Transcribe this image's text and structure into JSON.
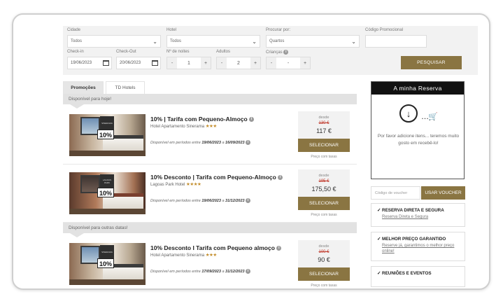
{
  "search": {
    "labels": {
      "city": "Cidade",
      "hotel": "Hotel",
      "search_by": "Procurar por:",
      "promo": "Código Promocional",
      "checkin": "Check-in",
      "checkout": "Check-Out",
      "nights": "Nº de noites",
      "adults": "Adultos",
      "children": "Crianças"
    },
    "values": {
      "city": "Todos",
      "hotel": "Todos",
      "search_by": "Quartos",
      "promo": "",
      "checkin": "19/06/2023",
      "checkout": "20/06/2023",
      "nights": "1",
      "adults": "2",
      "children": "-"
    },
    "minus": "-",
    "plus": "+",
    "submit": "PESQUISAR"
  },
  "tabs": [
    {
      "label": "Promoções",
      "active": true
    },
    {
      "label": "TD Hotels",
      "active": false
    }
  ],
  "sections": {
    "today": "Disponível para hoje!",
    "other": "Disponível para outras datas!"
  },
  "offers": [
    {
      "title": "10% | Tarifa com Pequeno-Almoço",
      "hotel": "Hotel Apartamento Sinerama",
      "stars": "★★★",
      "period_prefix": "Disponível em períodos entre",
      "from_date": "19/06/2023",
      "connector": "a",
      "to_date": "16/09/2023",
      "price_from": "desde",
      "old_price": "130 €",
      "price": "117 €",
      "button": "SELECIONAR",
      "taxes": "Preço com taxas",
      "photo_badge": "10%",
      "photo_sign": "SINERAMA"
    },
    {
      "title": "10% Desconto | Tarifa com Pequeno-Almoço",
      "hotel": "Lagoas Park Hotel",
      "stars": "★★★★",
      "period_prefix": "Disponível em períodos entre",
      "from_date": "19/06/2023",
      "connector": "a",
      "to_date": "31/12/2023",
      "price_from": "desde",
      "old_price": "195 €",
      "price": "175,50 €",
      "button": "SELECIONAR",
      "taxes": "Preço com taxas",
      "photo_badge": "10%",
      "photo_sign": "LAGOAS PARK"
    },
    {
      "title": "10% Desconto I Tarifa com Pequeno almoço",
      "hotel": "Hotel Apartamento Sinerama",
      "stars": "★★★",
      "period_prefix": "Disponível em períodos entre",
      "from_date": "17/09/2023",
      "connector": "a",
      "to_date": "31/12/2023",
      "price_from": "desde",
      "old_price": "100 €",
      "price": "90 €",
      "button": "SELECIONAR",
      "taxes": "Preço com taxas",
      "photo_badge": "10%",
      "photo_sign": "SINERAMA"
    }
  ],
  "reservation": {
    "title": "A minha Reserva",
    "empty_text": "Por favor adicione itens... teremos muito gosto em recebê-lo!"
  },
  "voucher": {
    "placeholder": "Código de voucher",
    "button": "USAR VOUCHER"
  },
  "features": [
    {
      "title": "✓ RESERVA DIRETA E SEGURA",
      "link": "Reserva Direta e Segura"
    },
    {
      "title": "✓ MELHOR PREÇO GARANTIDO",
      "link": "Reserve já, garantimos o melhor preço online!"
    },
    {
      "title": "✓ REUNIÕES E EVENTOS",
      "link": ""
    }
  ],
  "colors": {
    "accent": "#8a7542",
    "header_dark": "#111111",
    "old_price": "#c0392b",
    "stars": "#c38d2b"
  },
  "icons": {
    "select_chevron": "chevron-down-icon",
    "date": "calendar-icon",
    "info": "info-icon",
    "download": "download-circle-icon",
    "cart": "cart-icon"
  }
}
